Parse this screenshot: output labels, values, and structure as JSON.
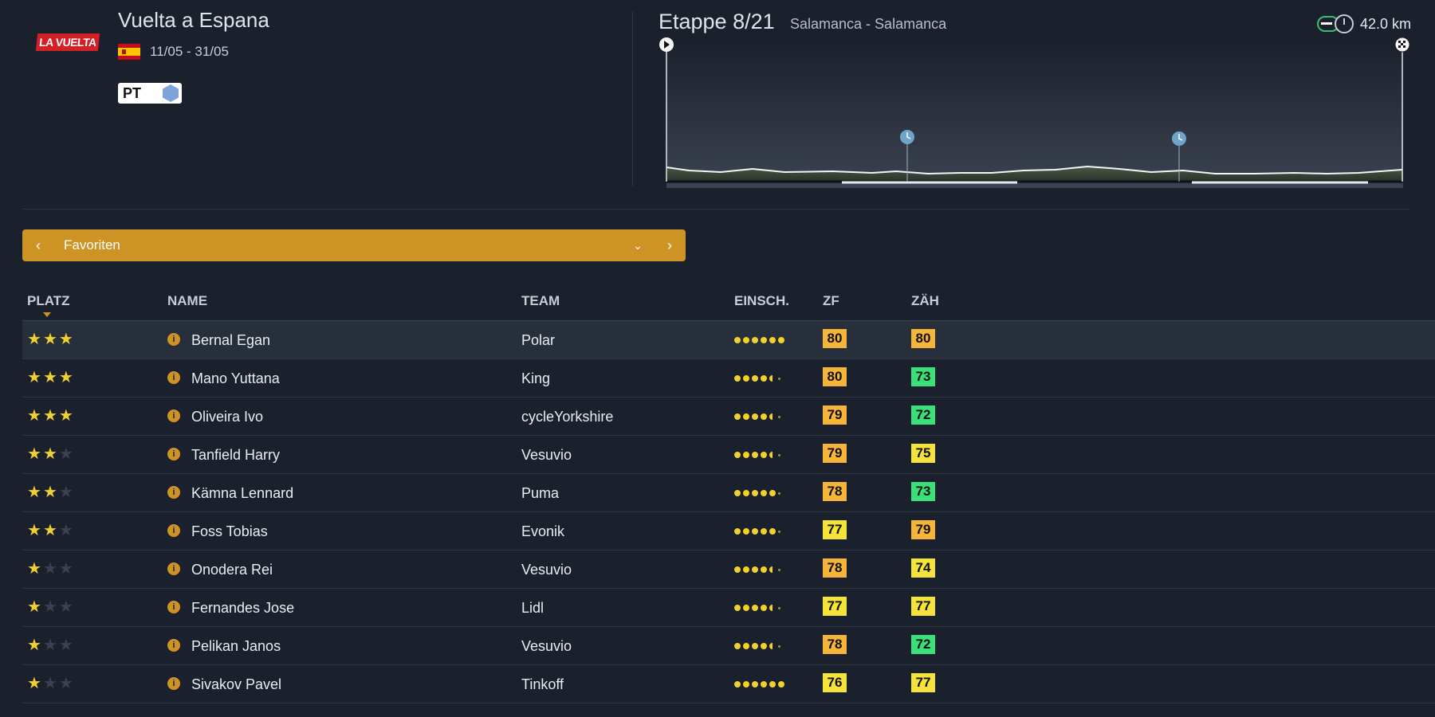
{
  "race": {
    "logo_text": "LA VUELTA",
    "title": "Vuelta a Espana",
    "flag": "spain-flag",
    "dates": "11/05 - 31/05",
    "badge_text": "PT"
  },
  "stage": {
    "title": "Etappe 8/21",
    "route": "Salamanca - Salamanca",
    "distance": "42.0 km",
    "profile_markers": [
      "start-flag",
      "time-check",
      "time-check",
      "finish-flag"
    ]
  },
  "filter": {
    "label": "Favoriten",
    "prev_icon": "chevron-left-icon",
    "dropdown_icon": "chevron-down-icon",
    "next_icon": "chevron-right-icon",
    "accent_color": "#cd9325"
  },
  "table": {
    "headers": [
      "PLATZ",
      "NAME",
      "TEAM",
      "EINSCH.",
      "ZF",
      "ZÄH"
    ],
    "sorted_column": "PLATZ",
    "colors": {
      "star": "#f1d22c",
      "orange": "#f5b43a",
      "yellow": "#f3e33b",
      "green": "#38e07a"
    },
    "rows": [
      {
        "stars": 3,
        "name": "Bernal Egan",
        "team": "Polar",
        "rating": 6,
        "zf": "80",
        "zf_color": "orange",
        "zah": "80",
        "zah_color": "orange",
        "selected": true
      },
      {
        "stars": 3,
        "name": "Mano Yuttana",
        "team": "King",
        "rating": 4.5,
        "zf": "80",
        "zf_color": "orange",
        "zah": "73",
        "zah_color": "green"
      },
      {
        "stars": 3,
        "name": "Oliveira Ivo",
        "team": "cycleYorkshire",
        "rating": 4.5,
        "zf": "79",
        "zf_color": "orange",
        "zah": "72",
        "zah_color": "green"
      },
      {
        "stars": 2,
        "name": "Tanfield Harry",
        "team": "Vesuvio",
        "rating": 4.5,
        "zf": "79",
        "zf_color": "orange",
        "zah": "75",
        "zah_color": "yellow"
      },
      {
        "stars": 2,
        "name": "Kämna Lennard",
        "team": "Puma",
        "rating": 5,
        "zf": "78",
        "zf_color": "orange",
        "zah": "73",
        "zah_color": "green"
      },
      {
        "stars": 2,
        "name": "Foss Tobias",
        "team": "Evonik",
        "rating": 5,
        "zf": "77",
        "zf_color": "yellow",
        "zah": "79",
        "zah_color": "orange"
      },
      {
        "stars": 1,
        "name": "Onodera Rei",
        "team": "Vesuvio",
        "rating": 4.5,
        "zf": "78",
        "zf_color": "orange",
        "zah": "74",
        "zah_color": "yellow"
      },
      {
        "stars": 1,
        "name": "Fernandes Jose",
        "team": "Lidl",
        "rating": 4.5,
        "zf": "77",
        "zf_color": "yellow",
        "zah": "77",
        "zah_color": "yellow"
      },
      {
        "stars": 1,
        "name": "Pelikan Janos",
        "team": "Vesuvio",
        "rating": 4.5,
        "zf": "78",
        "zf_color": "orange",
        "zah": "72",
        "zah_color": "green"
      },
      {
        "stars": 1,
        "name": "Sivakov Pavel",
        "team": "Tinkoff",
        "rating": 6,
        "zf": "76",
        "zf_color": "yellow",
        "zah": "77",
        "zah_color": "yellow"
      }
    ]
  }
}
